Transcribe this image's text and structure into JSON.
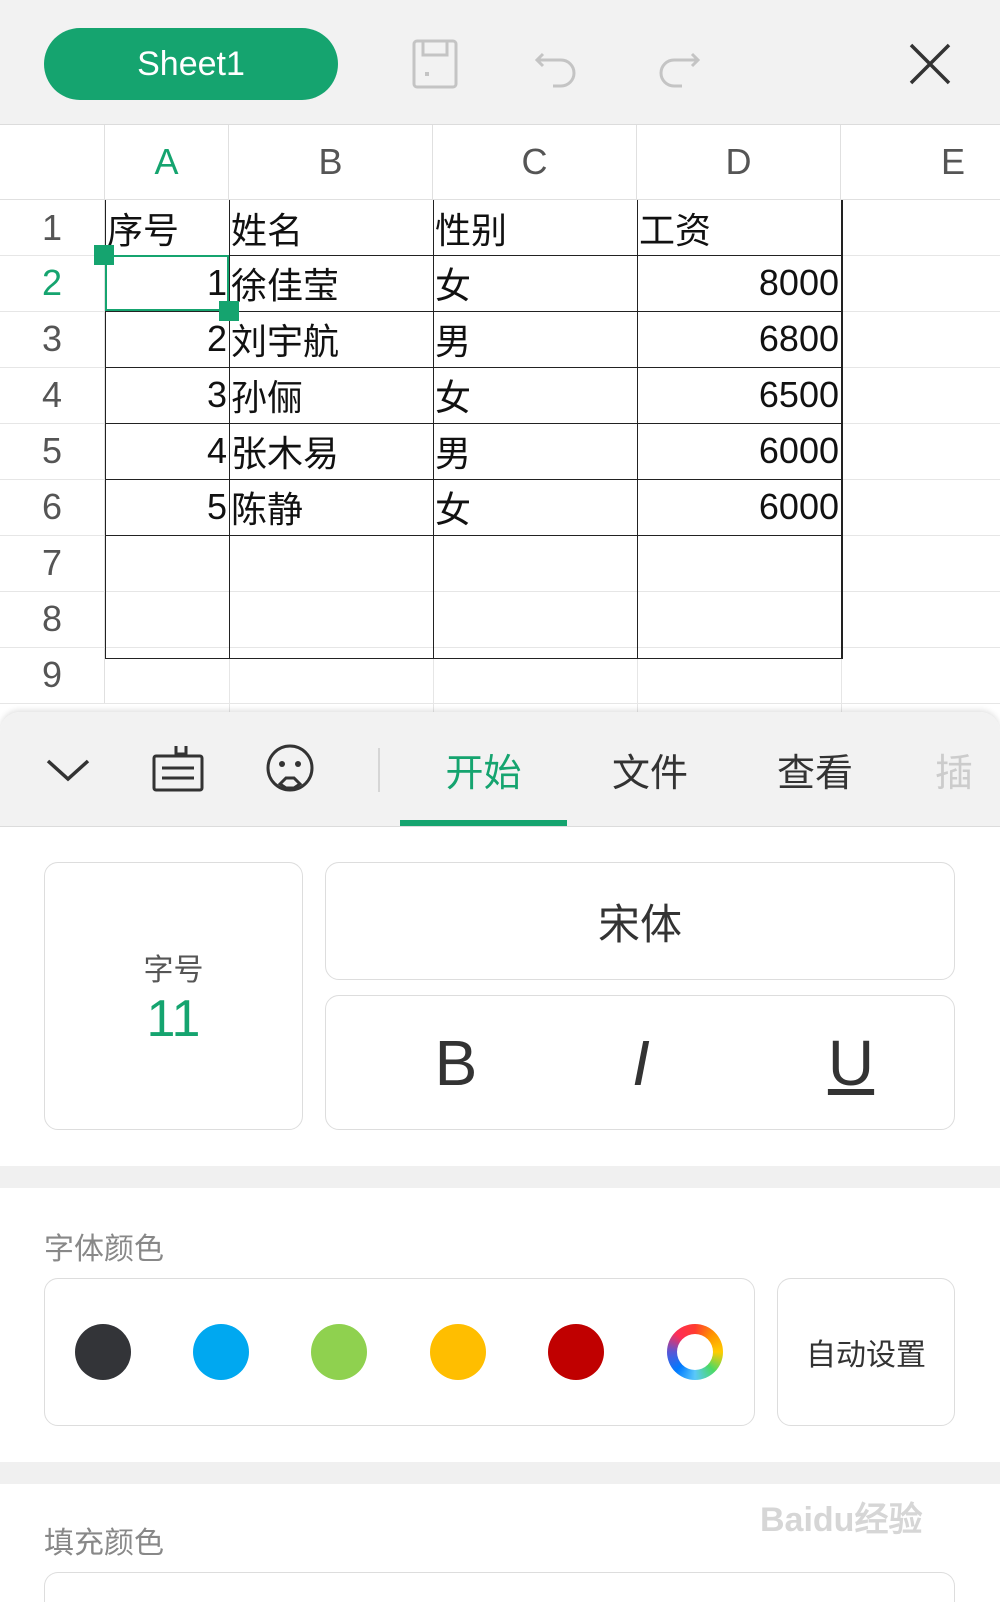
{
  "topbar": {
    "sheet_name": "Sheet1",
    "icons": [
      "save-icon",
      "undo-icon",
      "redo-icon",
      "close-icon"
    ]
  },
  "grid": {
    "columns": [
      "A",
      "B",
      "C",
      "D",
      "E"
    ],
    "rows": [
      "1",
      "2",
      "3",
      "4",
      "5",
      "6",
      "7",
      "8",
      "9"
    ],
    "active_column": "A",
    "active_row": "2",
    "cells": {
      "header": [
        "序号",
        "姓名",
        "性别",
        "工资"
      ],
      "data": [
        [
          "1",
          "徐佳莹",
          "女",
          "8000"
        ],
        [
          "2",
          "刘宇航",
          "男",
          "6800"
        ],
        [
          "3",
          "孙俪",
          "女",
          "6500"
        ],
        [
          "4",
          "张木易",
          "男",
          "6000"
        ],
        [
          "5",
          "陈静",
          "女",
          "6000"
        ]
      ]
    },
    "accent_color": "#15a46f"
  },
  "toolbar": {
    "icons": [
      "collapse-chevron-icon",
      "keyboard-icon",
      "emoji-icon"
    ],
    "tabs": [
      "开始",
      "文件",
      "查看",
      "插"
    ],
    "active_tab": "开始"
  },
  "format": {
    "font_size_label": "字号",
    "font_size_value": "11",
    "font_name": "宋体",
    "bold_label": "B",
    "italic_label": "I",
    "underline_label": "U"
  },
  "font_color": {
    "title": "字体颜色",
    "swatches": [
      "#333438",
      "#00a8f0",
      "#8fd14f",
      "#ffbe00",
      "#c00000",
      "custom-color-wheel"
    ],
    "auto_label": "自动设置"
  },
  "fill_color": {
    "title": "填充颜色"
  },
  "watermark": "Baidu经验"
}
